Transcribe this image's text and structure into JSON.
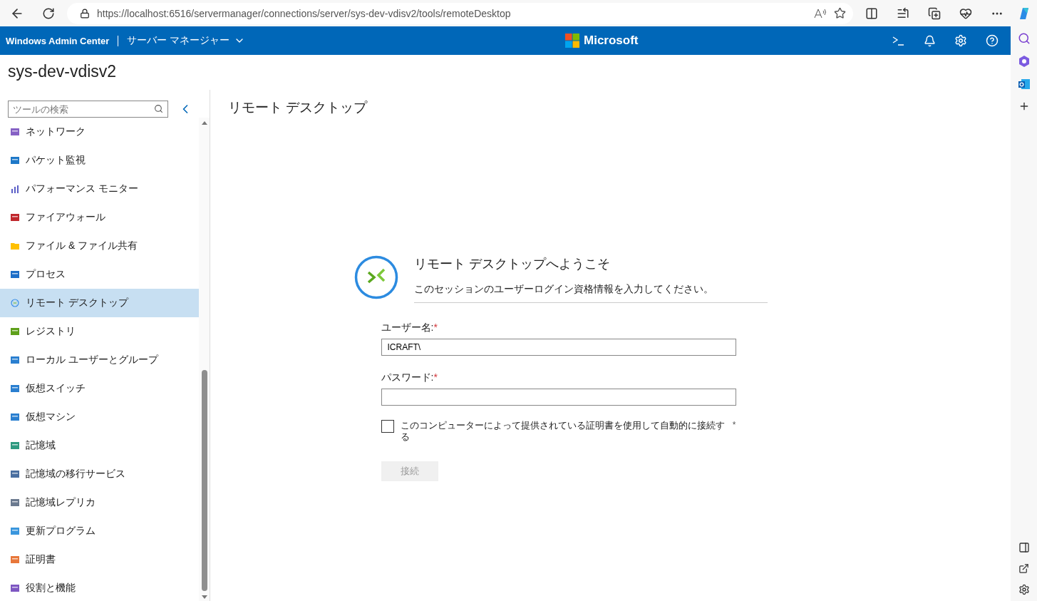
{
  "browser": {
    "url": "https://localhost:6516/servermanager/connections/server/sys-dev-vdisv2/tools/remoteDesktop"
  },
  "header": {
    "product": "Windows Admin Center",
    "tool": "サーバー マネージャー",
    "brand": "Microsoft"
  },
  "server": "sys-dev-vdisv2",
  "sidebar": {
    "search": {
      "placeholder": "ツールの検索"
    },
    "items": [
      {
        "label": "ネットワーク",
        "selected": false
      },
      {
        "label": "パケット監視",
        "selected": false
      },
      {
        "label": "パフォーマンス モニター",
        "selected": false
      },
      {
        "label": "ファイアウォール",
        "selected": false
      },
      {
        "label": "ファイル & ファイル共有",
        "selected": false
      },
      {
        "label": "プロセス",
        "selected": false
      },
      {
        "label": "リモート デスクトップ",
        "selected": true
      },
      {
        "label": "レジストリ",
        "selected": false
      },
      {
        "label": "ローカル ユーザーとグループ",
        "selected": false
      },
      {
        "label": "仮想スイッチ",
        "selected": false
      },
      {
        "label": "仮想マシン",
        "selected": false
      },
      {
        "label": "記憶域",
        "selected": false
      },
      {
        "label": "記憶域の移行サービス",
        "selected": false
      },
      {
        "label": "記憶域レプリカ",
        "selected": false
      },
      {
        "label": "更新プログラム",
        "selected": false
      },
      {
        "label": "証明書",
        "selected": false
      },
      {
        "label": "役割と機能",
        "selected": false
      }
    ]
  },
  "page": {
    "title": "リモート デスクトップ"
  },
  "login": {
    "heading": "リモート デスクトップへようこそ",
    "subheading": "このセッションのユーザーログイン資格情報を入力してください。",
    "fields": [
      {
        "label": "ユーザー名:",
        "required_mark": "*",
        "value": "ICRAFT\\"
      },
      {
        "label": "パスワード:",
        "required_mark": "*"
      }
    ],
    "checkbox": {
      "label": "このコンピューターによって提供されている証明書を使用して自動的に接続する",
      "checked": false,
      "mark": "*"
    },
    "button": {
      "label": "接続",
      "disabled": true
    }
  }
}
